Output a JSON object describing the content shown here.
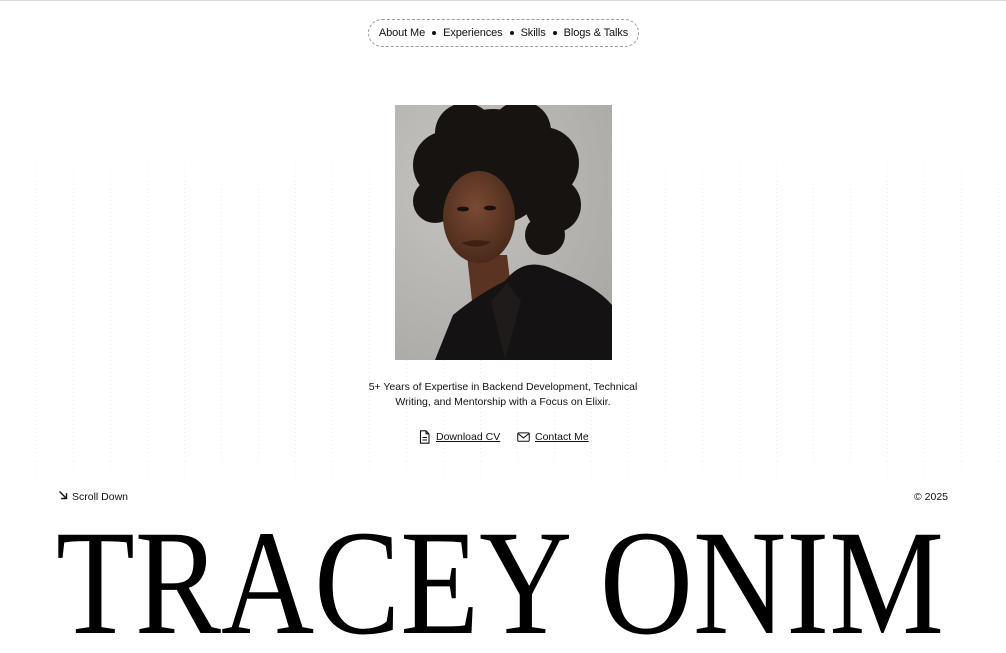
{
  "nav": {
    "items": [
      {
        "label": "About Me"
      },
      {
        "label": "Experiences"
      },
      {
        "label": "Skills"
      },
      {
        "label": "Blogs & Talks"
      }
    ]
  },
  "profile": {
    "photo": "portrait-photo",
    "tagline": "5+ Years of Expertise in Backend Development, Technical Writing, and Mentorship with a Focus on Elixir."
  },
  "actions": {
    "download_cv": {
      "label": "Download CV",
      "icon": "document-icon"
    },
    "contact_me": {
      "label": "Contact Me",
      "icon": "mail-icon"
    }
  },
  "footer": {
    "scroll_down": {
      "label": "Scroll Down",
      "icon": "arrow-down-right-icon"
    },
    "copyright": "© 2025"
  },
  "hero": {
    "name": "TRACEY ONIM"
  },
  "colors": {
    "background": "#ffffff",
    "text": "#111111",
    "pill_border": "#9a9a9a",
    "photo_backdrop": "#b8b6b2"
  }
}
